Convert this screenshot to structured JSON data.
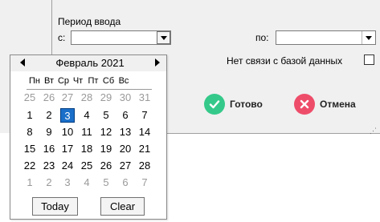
{
  "period": {
    "title": "Период ввода",
    "from_label": "с:",
    "to_label": "по:"
  },
  "no_db_label": "Нет связи с базой данных",
  "actions": {
    "done": "Готово",
    "cancel": "Отмена"
  },
  "calendar": {
    "month_label": "Февраль 2021",
    "weekdays": [
      "Пн",
      "Вт",
      "Ср",
      "Чт",
      "Пт",
      "Сб",
      "Вс"
    ],
    "weeks": [
      [
        "25",
        "26",
        "27",
        "28",
        "29",
        "30",
        "31"
      ],
      [
        "1",
        "2",
        "3",
        "4",
        "5",
        "6",
        "7"
      ],
      [
        "8",
        "9",
        "10",
        "11",
        "12",
        "13",
        "14"
      ],
      [
        "15",
        "16",
        "17",
        "18",
        "19",
        "20",
        "21"
      ],
      [
        "22",
        "23",
        "24",
        "25",
        "26",
        "27",
        "28"
      ],
      [
        "1",
        "2",
        "3",
        "4",
        "5",
        "6",
        "7"
      ]
    ],
    "selected_day": "3",
    "today_label": "Today",
    "clear_label": "Clear"
  },
  "colors": {
    "selected": "#1a6fc9",
    "ok": "#34c98a",
    "cancel": "#ee4d6a"
  }
}
